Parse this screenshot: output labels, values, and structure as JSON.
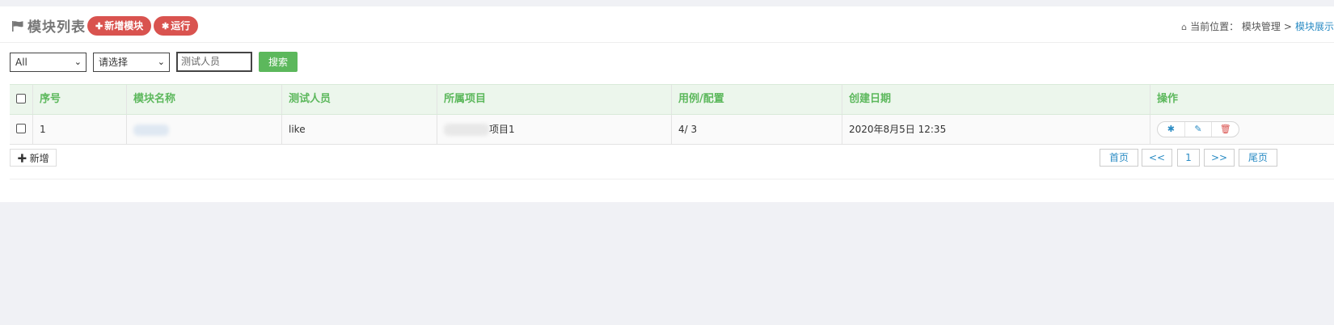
{
  "header": {
    "title": "模块列表",
    "add_module_label": "新增模块",
    "run_label": "运行",
    "breadcrumb_prefix": "当前位置：",
    "breadcrumb_parent": "模块管理",
    "breadcrumb_separator": ">",
    "breadcrumb_current": "模块展示"
  },
  "filters": {
    "select1_value": "All",
    "select2_value": "请选择",
    "search_placeholder": "测试人员",
    "search_button": "搜索"
  },
  "table": {
    "columns": [
      "序号",
      "模块名称",
      "测试人员",
      "所属项目",
      "用例/配置",
      "创建日期",
      "操作"
    ],
    "rows": [
      {
        "index": "1",
        "module_name": "",
        "tester": "like",
        "project_suffix": "项目1",
        "case_config": "4/ 3",
        "created": "2020年8月5日 12:35"
      }
    ]
  },
  "footer": {
    "add_label": "新增",
    "pager": {
      "first": "首页",
      "prev": "<<",
      "current": "1",
      "next": ">>",
      "last": "尾页"
    }
  },
  "colors": {
    "accent_red": "#d9534f",
    "accent_green": "#5cb85c",
    "link_blue": "#2b8cc4",
    "table_header_bg": "#ecf6ec"
  }
}
